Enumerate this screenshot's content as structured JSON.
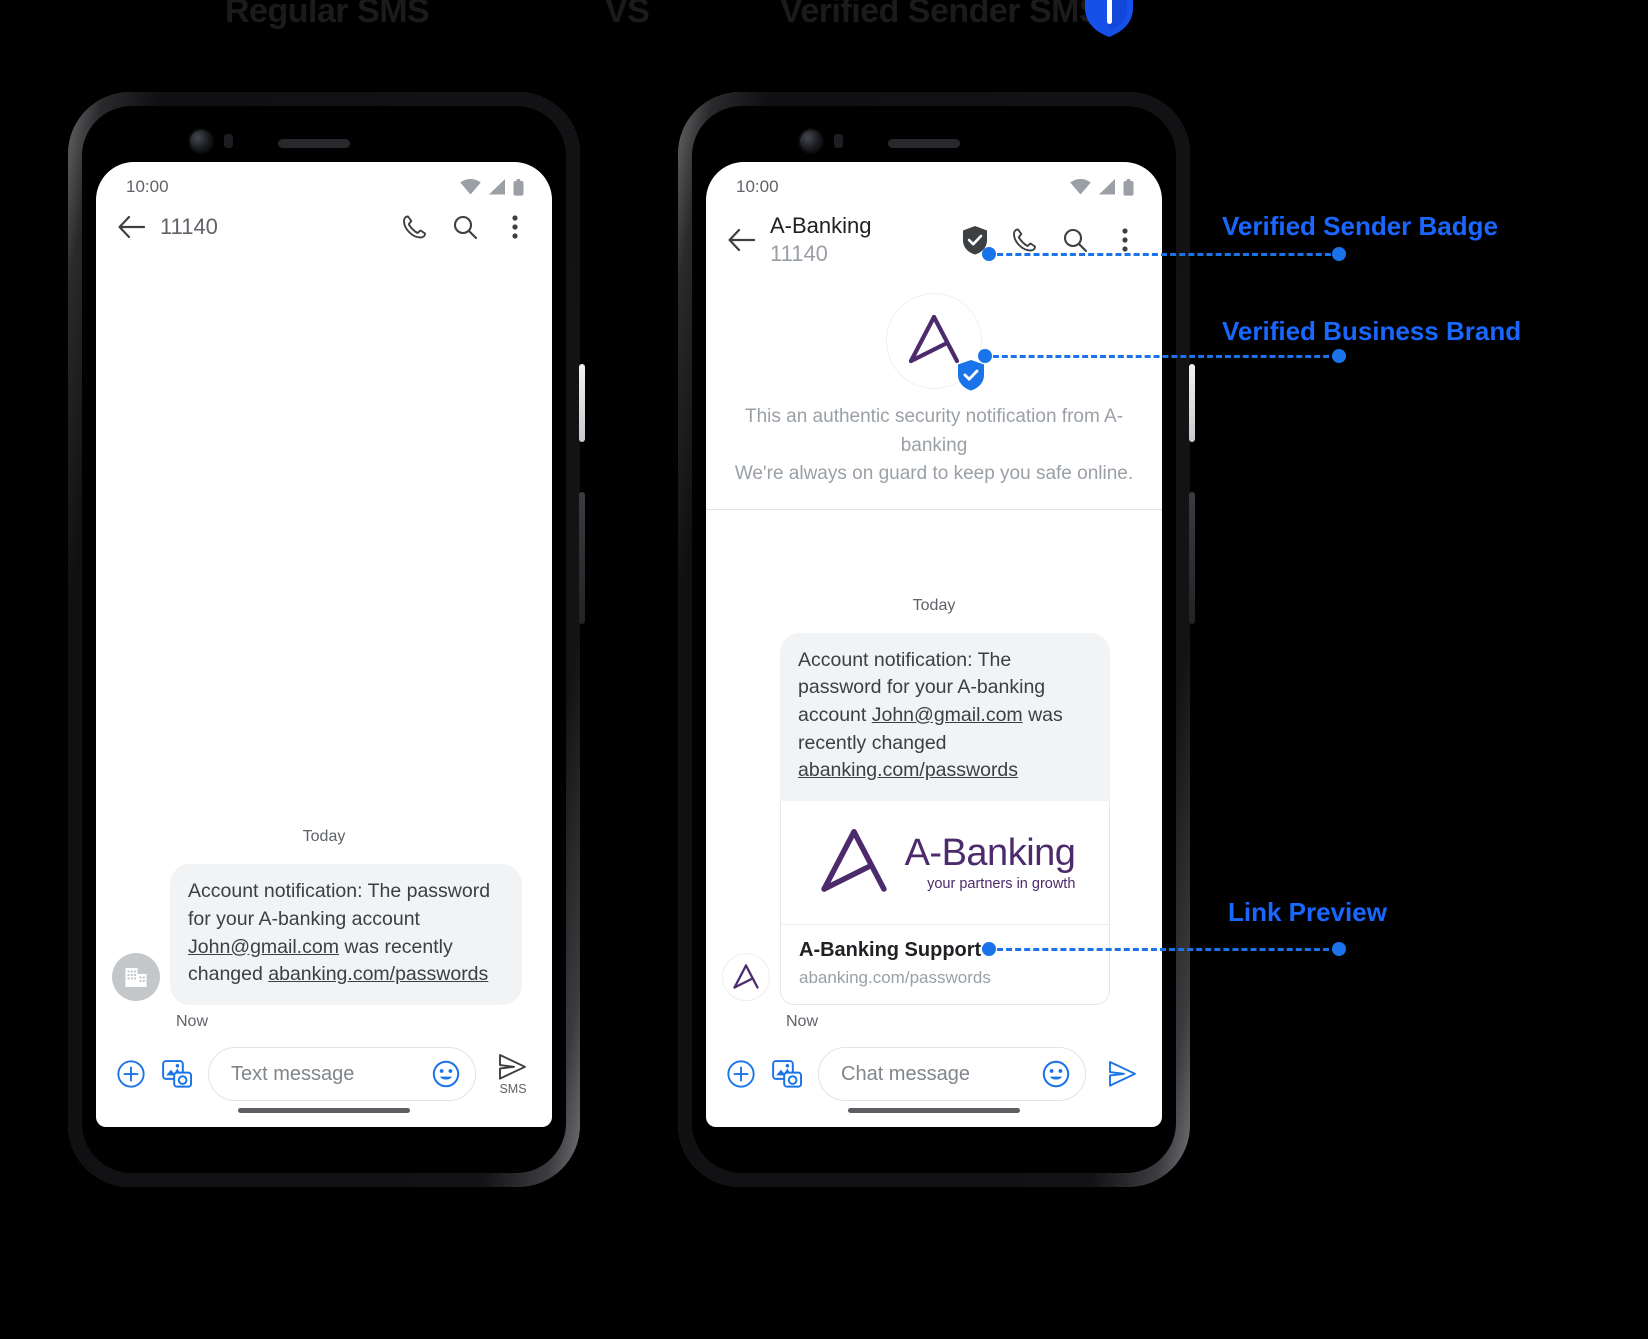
{
  "headings": {
    "left": "Regular SMS",
    "vs": "VS",
    "right": "Verified Sender SMS",
    "shield_icon": "shield-icon"
  },
  "colors": {
    "accent_blue": "#1a73e8",
    "brand_purple": "#4c2a6c",
    "bubble_gray": "#f1f3f4",
    "muted_text": "#9aa0a6"
  },
  "phone_left": {
    "status": {
      "time": "10:00",
      "wifi_icon": "wifi-icon",
      "signal_icon": "signal-icon",
      "battery_icon": "battery-icon"
    },
    "appbar": {
      "back_icon": "back-arrow-icon",
      "title": "11140",
      "call_icon": "phone-call-icon",
      "search_icon": "search-icon",
      "overflow_icon": "more-vert-icon"
    },
    "thread": {
      "day": "Today",
      "avatar_icon": "business-building-icon",
      "message": {
        "line1": "Account notification: The password",
        "line2": "for your  A-banking account",
        "email": "John@gmail.com",
        "line3_after_email": " was recently",
        "line4_prefix": "changed  ",
        "link": "abanking.com/passwords"
      },
      "time": "Now"
    },
    "composer": {
      "add_icon": "plus-circle-icon",
      "gallery_icon": "image-camera-icon",
      "placeholder": "Text message",
      "emoji_icon": "emoji-smile-icon",
      "send_icon": "send-arrow-icon",
      "send_label": "SMS"
    }
  },
  "phone_right": {
    "status": {
      "time": "10:00",
      "wifi_icon": "wifi-icon",
      "signal_icon": "signal-icon",
      "battery_icon": "battery-icon"
    },
    "appbar": {
      "back_icon": "back-arrow-icon",
      "title": "A-Banking",
      "subtitle": "11140",
      "verified_icon": "verified-shield-check-icon",
      "call_icon": "phone-call-icon",
      "search_icon": "search-icon",
      "overflow_icon": "more-vert-icon"
    },
    "brand_header": {
      "avatar_icon": "a-banking-logo-icon",
      "verified_badge_icon": "blue-shield-check-icon",
      "line1": "This an authentic security notification from  A-banking",
      "line2": "We're always on guard to keep you safe online."
    },
    "thread": {
      "day": "Today",
      "avatar_icon": "a-banking-logo-icon",
      "message": {
        "line1": "Account notification: The password",
        "line2": "for your  A-banking account",
        "email": "John@gmail.com",
        "line3_after_email": " was recently",
        "line4_prefix": "changed  ",
        "link": "abanking.com/passwords"
      },
      "preview": {
        "logo_icon": "a-banking-logo-icon",
        "brand_name": "A-Banking",
        "tagline": "your partners in growth",
        "title": "A-Banking Support",
        "url": "abanking.com/passwords"
      },
      "time": "Now"
    },
    "composer": {
      "add_icon": "plus-circle-icon",
      "gallery_icon": "image-camera-icon",
      "placeholder": "Chat message",
      "emoji_icon": "emoji-smile-icon",
      "send_icon": "send-arrow-icon"
    }
  },
  "callouts": [
    {
      "label": "Verified Sender Badge"
    },
    {
      "label": "Verified Business Brand"
    },
    {
      "label": "Link Preview"
    }
  ]
}
